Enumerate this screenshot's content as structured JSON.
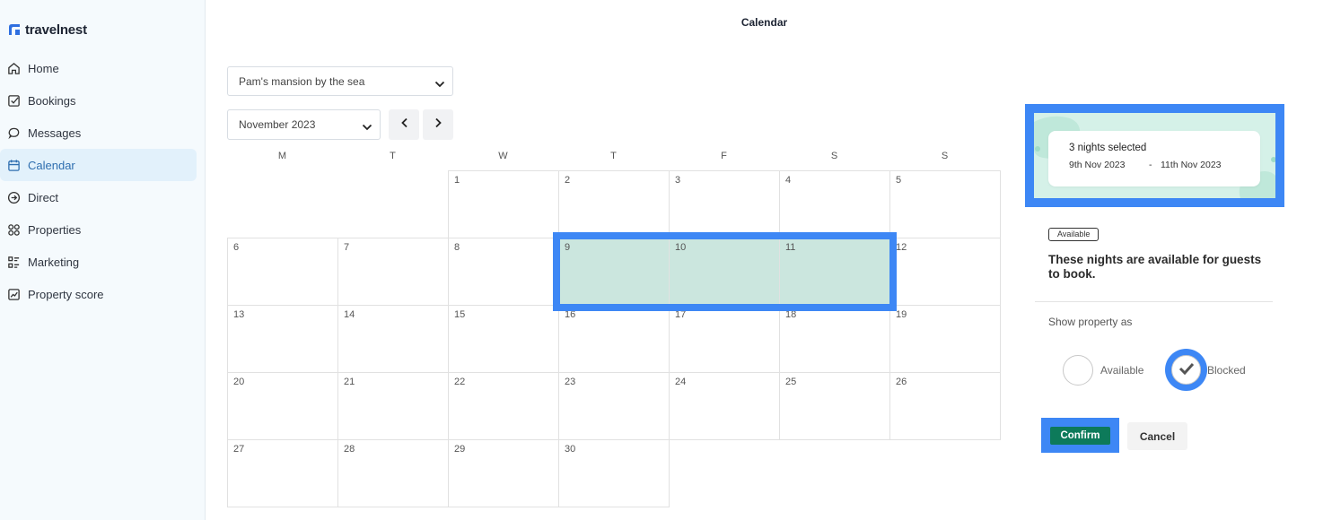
{
  "app": {
    "brand": "travelnest"
  },
  "sidebar": {
    "items": [
      {
        "label": "Home",
        "icon": "home-icon"
      },
      {
        "label": "Bookings",
        "icon": "checkbox-icon"
      },
      {
        "label": "Messages",
        "icon": "chat-icon"
      },
      {
        "label": "Calendar",
        "icon": "calendar-icon",
        "active": true
      },
      {
        "label": "Direct",
        "icon": "arrow-circle-icon"
      },
      {
        "label": "Properties",
        "icon": "grid-icon"
      },
      {
        "label": "Marketing",
        "icon": "list-icon"
      },
      {
        "label": "Property score",
        "icon": "chart-icon"
      }
    ]
  },
  "header": {
    "title": "Calendar"
  },
  "controls": {
    "property": "Pam's mansion by the sea",
    "month": "November 2023"
  },
  "calendar": {
    "weekdays": [
      "M",
      "T",
      "W",
      "T",
      "F",
      "S",
      "S"
    ],
    "first_weekday_index": 2,
    "days_in_month": 30,
    "selected_days": [
      9,
      10,
      11
    ]
  },
  "summary": {
    "nights": "3 nights selected",
    "start": "9th Nov 2023",
    "separator": "-",
    "end": "11th Nov 2023"
  },
  "status": {
    "badge": "Available",
    "message": "These nights are available for guests to book."
  },
  "show_as": {
    "label": "Show property as",
    "options": [
      {
        "label": "Available",
        "checked": false
      },
      {
        "label": "Blocked",
        "checked": true
      }
    ]
  },
  "actions": {
    "confirm": "Confirm",
    "cancel": "Cancel"
  },
  "colors": {
    "accent": "#3d87f5",
    "selection": "#cbe6de",
    "confirm": "#0d7a5a",
    "active_nav": "#2f6fb0"
  }
}
